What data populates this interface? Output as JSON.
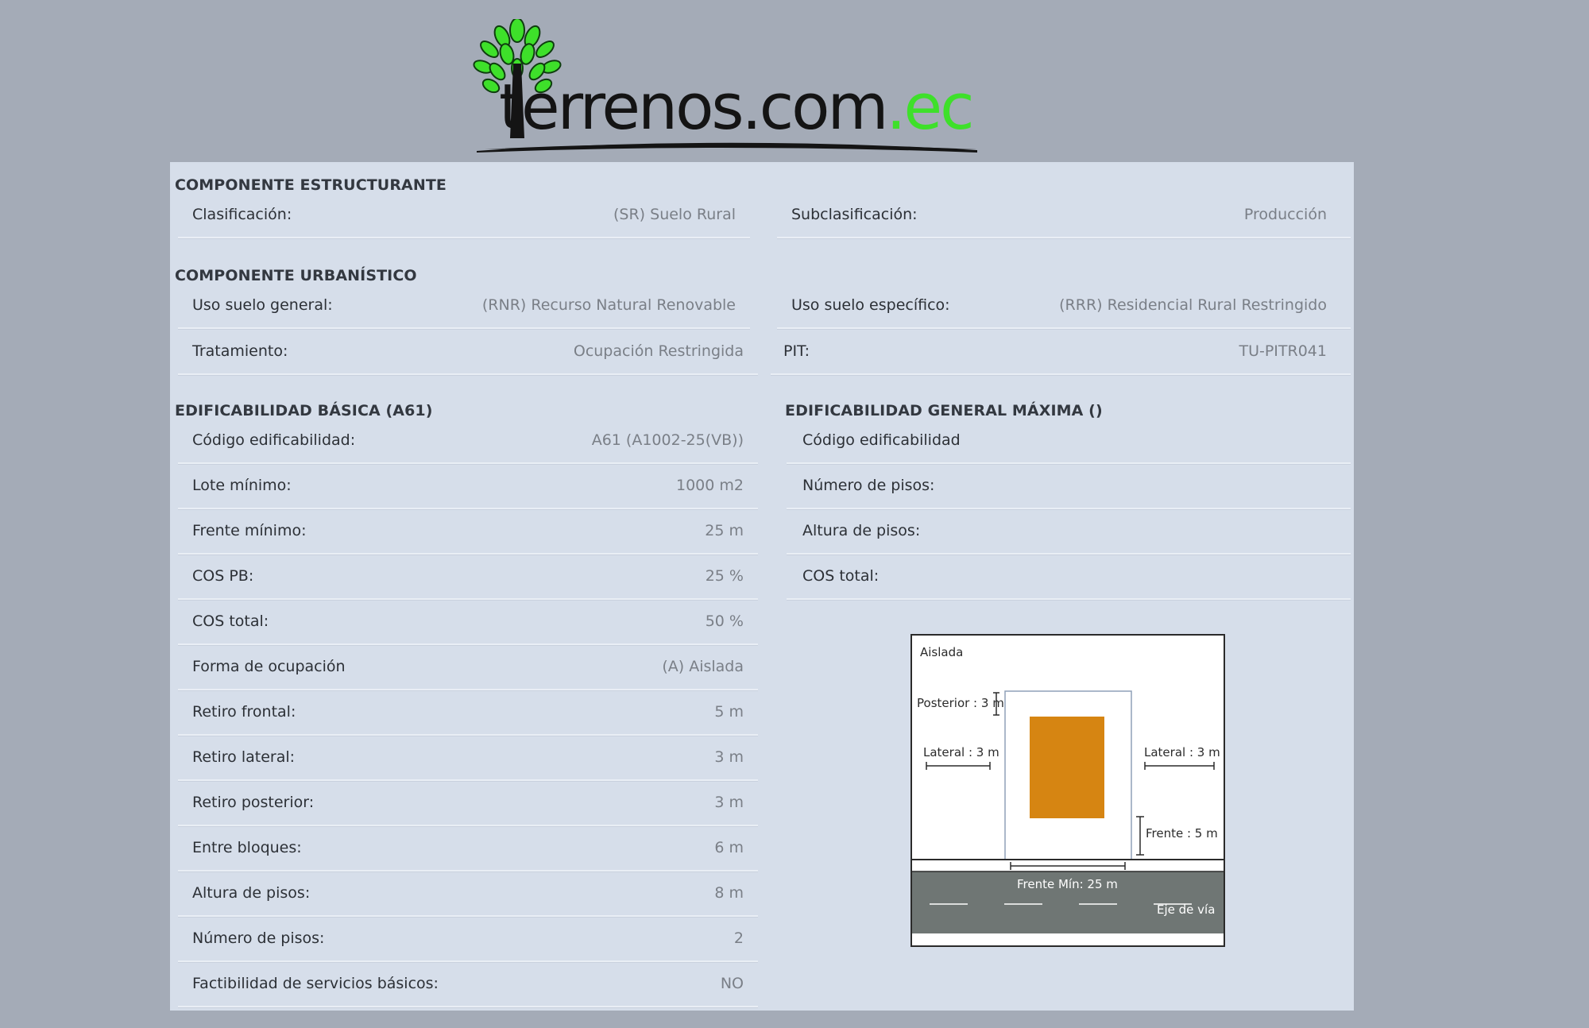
{
  "logo": {
    "text_main": "terrenos.com",
    "text_tld": ".ec",
    "leaf_color": "#3ee02a"
  },
  "sections": {
    "estructurante": {
      "title": "COMPONENTE ESTRUCTURANTE",
      "clasificacion": {
        "label": "Clasificación:",
        "value": "(SR) Suelo Rural"
      },
      "subclasificacion": {
        "label": "Subclasificación:",
        "value": "Producción"
      }
    },
    "urbanistico": {
      "title": "COMPONENTE URBANÍSTICO",
      "uso_general": {
        "label": "Uso suelo general:",
        "value": "(RNR) Recurso Natural Renovable"
      },
      "uso_especifico": {
        "label": "Uso suelo específico:",
        "value": "(RRR) Residencial Rural Restringido"
      },
      "tratamiento": {
        "label": "Tratamiento:",
        "value": "Ocupación Restringida"
      },
      "pit": {
        "label": "PIT:",
        "value": "TU-PITR041"
      }
    },
    "basica": {
      "title": "EDIFICABILIDAD BÁSICA (A61)",
      "rows": [
        {
          "label": "Código edificabilidad:",
          "value": "A61 (A1002-25(VB))"
        },
        {
          "label": "Lote mínimo:",
          "value": "1000 m2"
        },
        {
          "label": "Frente mínimo:",
          "value": "25 m"
        },
        {
          "label": "COS PB:",
          "value": "25 %"
        },
        {
          "label": "COS total:",
          "value": "50 %"
        },
        {
          "label": "Forma de ocupación",
          "value": "(A) Aislada"
        },
        {
          "label": "Retiro frontal:",
          "value": "5 m"
        },
        {
          "label": "Retiro lateral:",
          "value": "3 m"
        },
        {
          "label": "Retiro posterior:",
          "value": "3 m"
        },
        {
          "label": "Entre bloques:",
          "value": "6 m"
        },
        {
          "label": "Altura de pisos:",
          "value": "8 m"
        },
        {
          "label": "Número de pisos:",
          "value": "2"
        },
        {
          "label": "Factibilidad de servicios básicos:",
          "value": "NO"
        }
      ]
    },
    "maxima": {
      "title": "EDIFICABILIDAD GENERAL MÁXIMA ()",
      "rows": [
        {
          "label": "Código edificabilidad",
          "value": ""
        },
        {
          "label": "Número de pisos:",
          "value": ""
        },
        {
          "label": "Altura de pisos:",
          "value": ""
        },
        {
          "label": "COS total:",
          "value": ""
        }
      ]
    }
  },
  "diagram": {
    "title": "Aislada",
    "posterior": "Posterior : 3 m",
    "lateral_left": "Lateral : 3 m",
    "lateral_right": "Lateral : 3 m",
    "frente": "Frente : 5 m",
    "frente_min": "Frente Mín: 25 m",
    "eje_via": "Eje de vía",
    "building_color": "#d68512",
    "road_color": "#6f7674"
  }
}
